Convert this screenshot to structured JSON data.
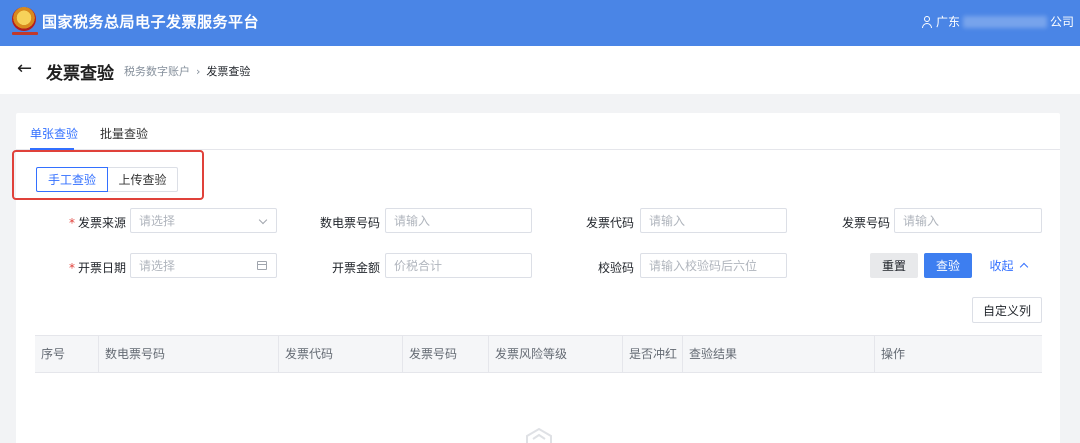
{
  "header": {
    "app_title": "国家税务总局电子发票服务平台",
    "user_prefix": "广东",
    "user_suffix": "公司"
  },
  "page": {
    "title": "发票查验",
    "breadcrumb": [
      "税务数字账户",
      "发票查验"
    ]
  },
  "tabs": [
    {
      "label": "单张查验",
      "active": true
    },
    {
      "label": "批量查验",
      "active": false
    }
  ],
  "modes": [
    {
      "label": "手工查验",
      "active": true
    },
    {
      "label": "上传查验",
      "active": false
    }
  ],
  "form": {
    "source": {
      "label": "发票来源",
      "required": true,
      "placeholder": "请选择"
    },
    "digital_no": {
      "label": "数电票号码",
      "placeholder": "请输入"
    },
    "code": {
      "label": "发票代码",
      "placeholder": "请输入"
    },
    "number": {
      "label": "发票号码",
      "placeholder": "请输入"
    },
    "date": {
      "label": "开票日期",
      "required": true,
      "placeholder": "请选择"
    },
    "amount": {
      "label": "开票金额",
      "placeholder": "价税合计"
    },
    "check_code": {
      "label": "校验码",
      "placeholder": "请输入校验码后六位"
    }
  },
  "buttons": {
    "reset": "重置",
    "query": "查验",
    "collapse": "收起",
    "custom_columns": "自定义列"
  },
  "table": {
    "columns": [
      "序号",
      "数电票号码",
      "发票代码",
      "发票号码",
      "发票风险等级",
      "是否冲红",
      "查验结果",
      "操作"
    ]
  },
  "colors": {
    "brand": "#4a85e6",
    "accent": "#3370ff",
    "highlight": "#e0413a"
  }
}
